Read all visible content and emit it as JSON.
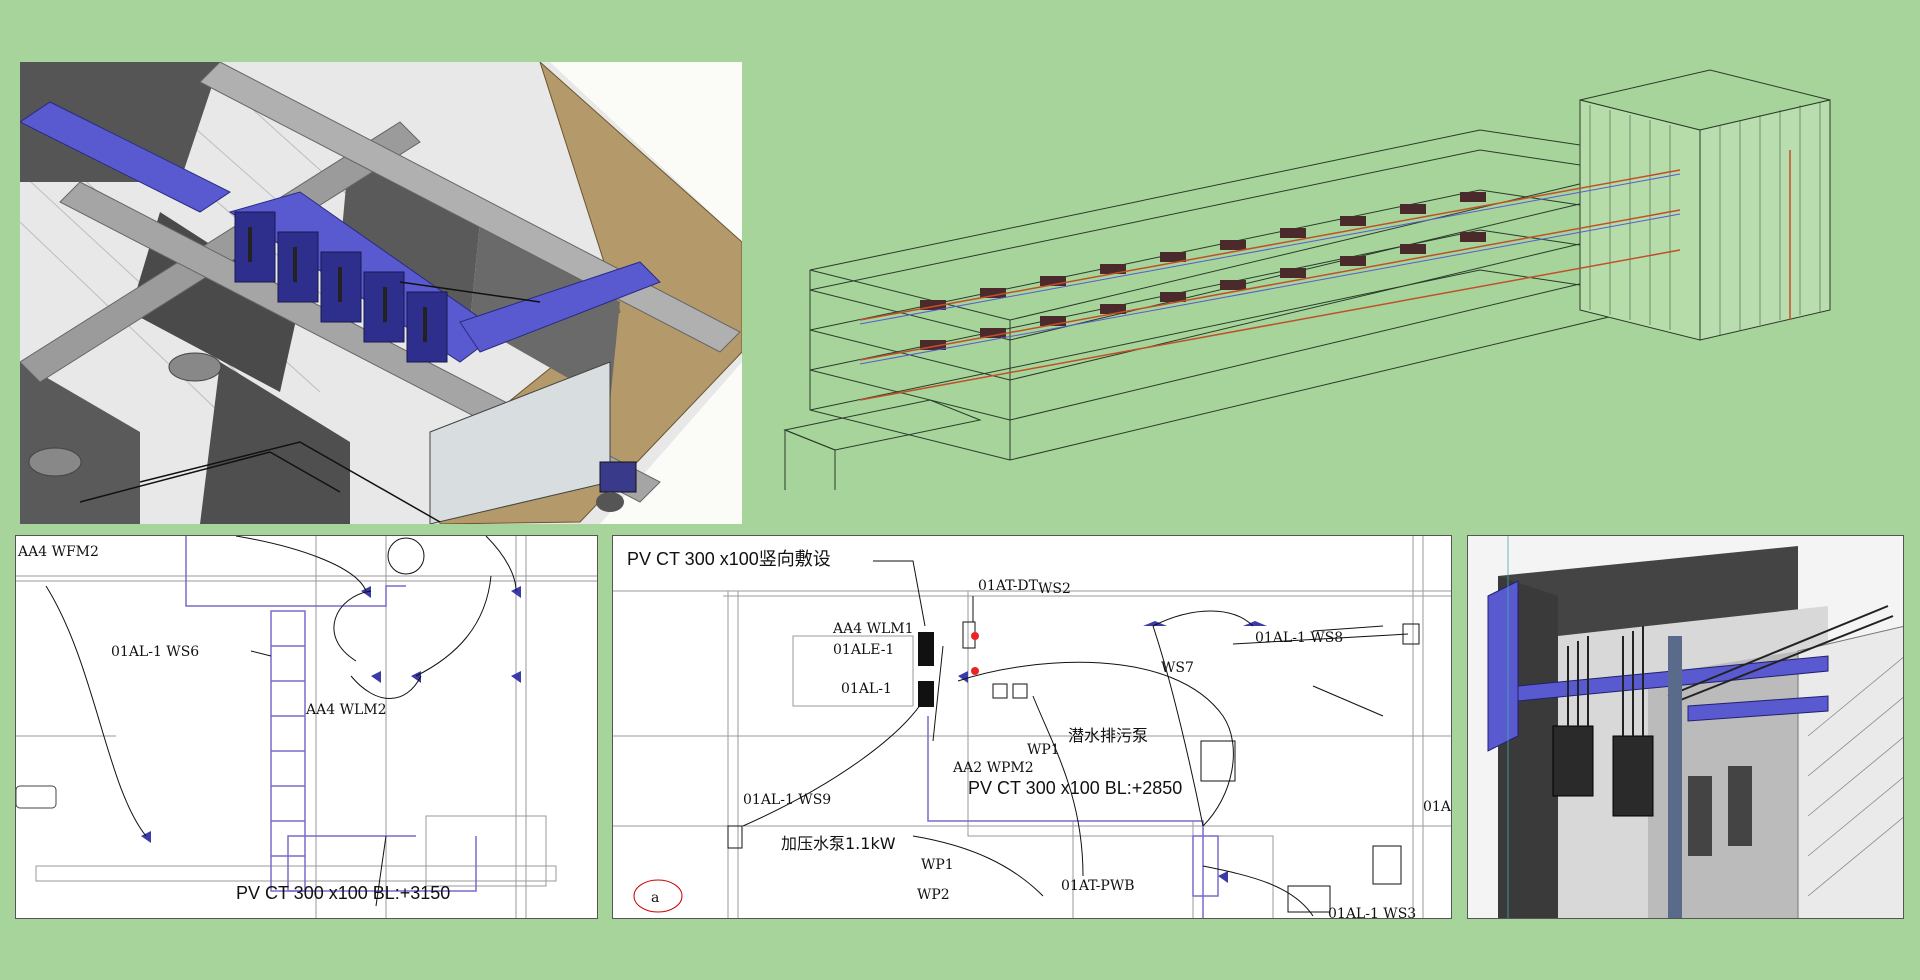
{
  "plan1": {
    "label_wpm2": "AA4 WFM2",
    "label_ws6": "01AL-1   WS6",
    "label_wlm2": "AA4 WLM2",
    "label_tray": "PV CT 300 x100 BL:+3150"
  },
  "plan2": {
    "label_vertical": "PV CT 300 x100竖向敷设",
    "label_dt": "01AT-DT",
    "label_ws2": "WS2",
    "label_wlm1": "AA4 WLM1",
    "label_ale1": "01ALE-1",
    "label_al1": "01AL-1",
    "label_ws8": "01AL-1  WS8",
    "label_ws7": "WS7",
    "label_pump": "潜水排污泵",
    "label_wp1a": "WP1",
    "label_wpm2": "AA2 WPM2",
    "label_tray": "PV CT 300 x100 BL:+2850",
    "label_ws9": "01AL-1   WS9",
    "label_booster": "加压水泵1.1kW",
    "label_wp1b": "WP1",
    "label_wp2": "WP2",
    "label_pwb": "01AT-PWB",
    "label_01a": "01A",
    "label_ws3": "01AL-1  WS3",
    "label_circle": "a"
  },
  "colors": {
    "background": "#a6d49a",
    "duct_blue": "#5a5ad0",
    "wire_red": "#c0502a"
  }
}
